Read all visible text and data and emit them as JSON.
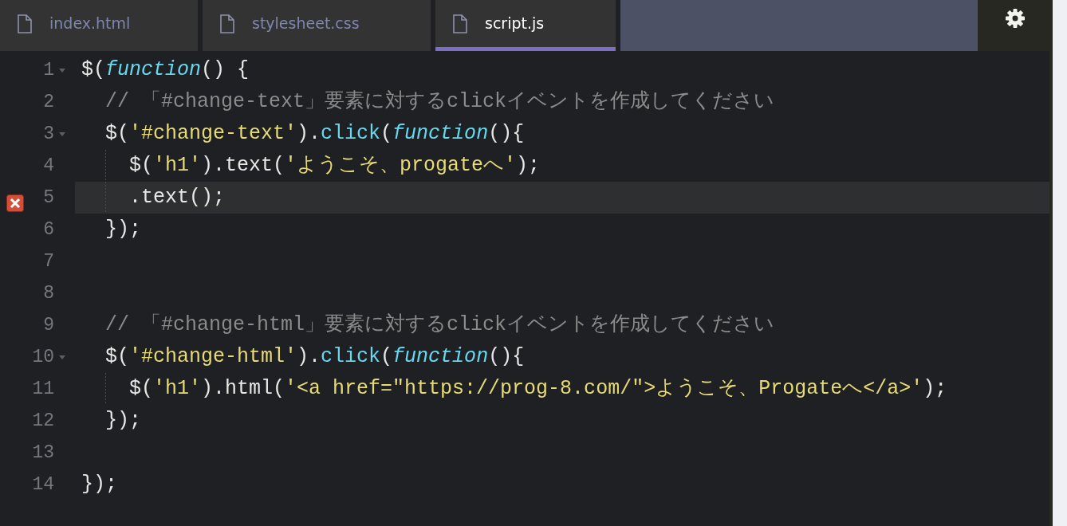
{
  "tabs": [
    {
      "label": "index.html",
      "selected": false
    },
    {
      "label": "stylesheet.css",
      "selected": false
    },
    {
      "label": "script.js",
      "selected": true
    }
  ],
  "lines": [
    {
      "number": "1",
      "foldable": true,
      "error": false,
      "active": false,
      "tokens": [
        {
          "kind": "plain",
          "text": "$("
        },
        {
          "kind": "keyword",
          "text": "function"
        },
        {
          "kind": "plain",
          "text": "() {"
        }
      ]
    },
    {
      "number": "2",
      "foldable": false,
      "error": false,
      "active": false,
      "tokens": [
        {
          "kind": "comment",
          "text": "  // 「#change-text」要素に対するclickイベントを作成してください"
        }
      ]
    },
    {
      "number": "3",
      "foldable": true,
      "error": false,
      "active": false,
      "tokens": [
        {
          "kind": "plain",
          "text": "  $("
        },
        {
          "kind": "string",
          "text": "'#change-text'"
        },
        {
          "kind": "plain",
          "text": ")."
        },
        {
          "kind": "method",
          "text": "click"
        },
        {
          "kind": "plain",
          "text": "("
        },
        {
          "kind": "keyword",
          "text": "function"
        },
        {
          "kind": "plain",
          "text": "(){"
        }
      ]
    },
    {
      "number": "4",
      "foldable": false,
      "error": false,
      "active": false,
      "tokens": [
        {
          "kind": "plain",
          "text": "    $("
        },
        {
          "kind": "string",
          "text": "'h1'"
        },
        {
          "kind": "plain",
          "text": ").text("
        },
        {
          "kind": "string",
          "text": "'ようこそ、progateへ'"
        },
        {
          "kind": "plain",
          "text": ");"
        }
      ]
    },
    {
      "number": "5",
      "foldable": false,
      "error": true,
      "active": true,
      "tokens": [
        {
          "kind": "plain",
          "text": "    .text();"
        }
      ]
    },
    {
      "number": "6",
      "foldable": false,
      "error": false,
      "active": false,
      "tokens": [
        {
          "kind": "plain",
          "text": "  });"
        }
      ]
    },
    {
      "number": "7",
      "foldable": false,
      "error": false,
      "active": false
    },
    {
      "number": "8",
      "foldable": false,
      "error": false,
      "active": false
    },
    {
      "number": "9",
      "foldable": false,
      "error": false,
      "active": false,
      "tokens": [
        {
          "kind": "comment",
          "text": "  // 「#change-html」要素に対するclickイベントを作成してください"
        }
      ]
    },
    {
      "number": "10",
      "foldable": true,
      "error": false,
      "active": false,
      "tokens": [
        {
          "kind": "plain",
          "text": "  $("
        },
        {
          "kind": "string",
          "text": "'#change-html'"
        },
        {
          "kind": "plain",
          "text": ")."
        },
        {
          "kind": "method",
          "text": "click"
        },
        {
          "kind": "plain",
          "text": "("
        },
        {
          "kind": "keyword",
          "text": "function"
        },
        {
          "kind": "plain",
          "text": "(){"
        }
      ]
    },
    {
      "number": "11",
      "foldable": false,
      "error": false,
      "active": false,
      "tokens": [
        {
          "kind": "plain",
          "text": "    $("
        },
        {
          "kind": "string",
          "text": "'h1'"
        },
        {
          "kind": "plain",
          "text": ").html("
        },
        {
          "kind": "string",
          "text": "'<a href=\"https://prog-8.com/\">ようこそ、Progateへ</a>'"
        },
        {
          "kind": "plain",
          "text": ");"
        }
      ]
    },
    {
      "number": "12",
      "foldable": false,
      "error": false,
      "active": false,
      "tokens": [
        {
          "kind": "plain",
          "text": "  });"
        }
      ]
    },
    {
      "number": "13",
      "foldable": false,
      "error": false,
      "active": false
    },
    {
      "number": "14",
      "foldable": false,
      "error": false,
      "active": false,
      "tokens": [
        {
          "kind": "plain",
          "text": "});"
        }
      ]
    }
  ]
}
